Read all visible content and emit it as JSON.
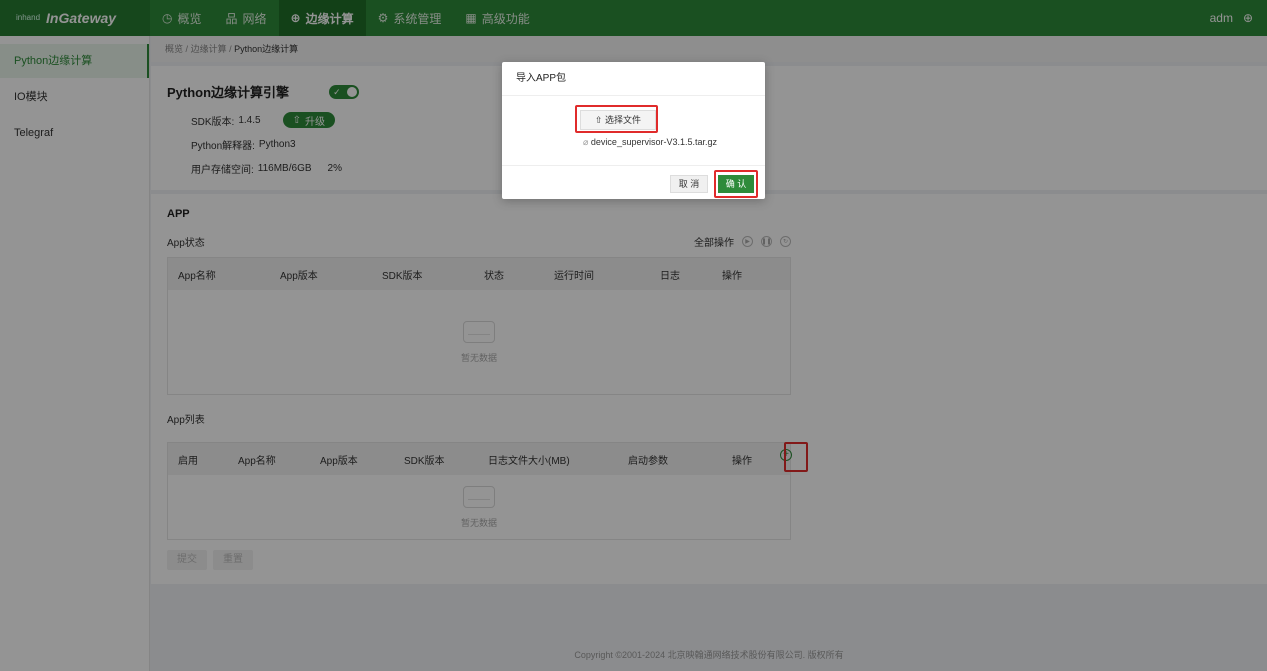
{
  "topbar": {
    "logo_mark": "inhand",
    "logo_text": "InGateway",
    "nav": [
      {
        "label": "概览",
        "icon": "◷"
      },
      {
        "label": "网络",
        "icon": "品"
      },
      {
        "label": "边缘计算",
        "icon": "⊕"
      },
      {
        "label": "系统管理",
        "icon": "⚙"
      },
      {
        "label": "高级功能",
        "icon": "▦"
      }
    ],
    "user": "adm",
    "globe_icon": "⊕"
  },
  "sidebar": {
    "items": [
      {
        "label": "Python边缘计算"
      },
      {
        "label": "IO模块"
      },
      {
        "label": "Telegraf"
      }
    ]
  },
  "breadcrumb": {
    "items": [
      "概览",
      "边缘计算",
      "Python边缘计算"
    ],
    "sep": "/"
  },
  "engine": {
    "title": "Python边缘计算引擎",
    "sdk_label": "SDK版本:",
    "sdk_value": "1.4.5",
    "upgrade_label": "升级",
    "interpreter_label": "Python解释器:",
    "interpreter_value": "Python3",
    "storage_label": "用户存储空间:",
    "storage_value": "116MB/6GB",
    "storage_percent": "2%"
  },
  "app_section": {
    "title": "APP",
    "status_label": "App状态",
    "all_ops_label": "全部操作",
    "status_columns": [
      "App名称",
      "App版本",
      "SDK版本",
      "状态",
      "运行时间",
      "日志",
      "操作"
    ],
    "empty_text": "暂无数据",
    "list_label": "App列表",
    "list_columns": [
      "启用",
      "App名称",
      "App版本",
      "SDK版本",
      "日志文件大小(MB)",
      "启动参数",
      "操作"
    ],
    "submit_label": "提交",
    "reset_label": "重置"
  },
  "footer": {
    "text": "Copyright ©2001-2024 北京映翰通网络技术股份有限公司. 版权所有"
  },
  "dialog": {
    "title": "导入APP包",
    "choose_label": "选择文件",
    "file_name": "device_supervisor-V3.1.5.tar.gz",
    "cancel_label": "取 消",
    "confirm_label": "确 认"
  },
  "colors": {
    "primary": "#2e8b3a",
    "highlight_box": "#e02b2b"
  }
}
